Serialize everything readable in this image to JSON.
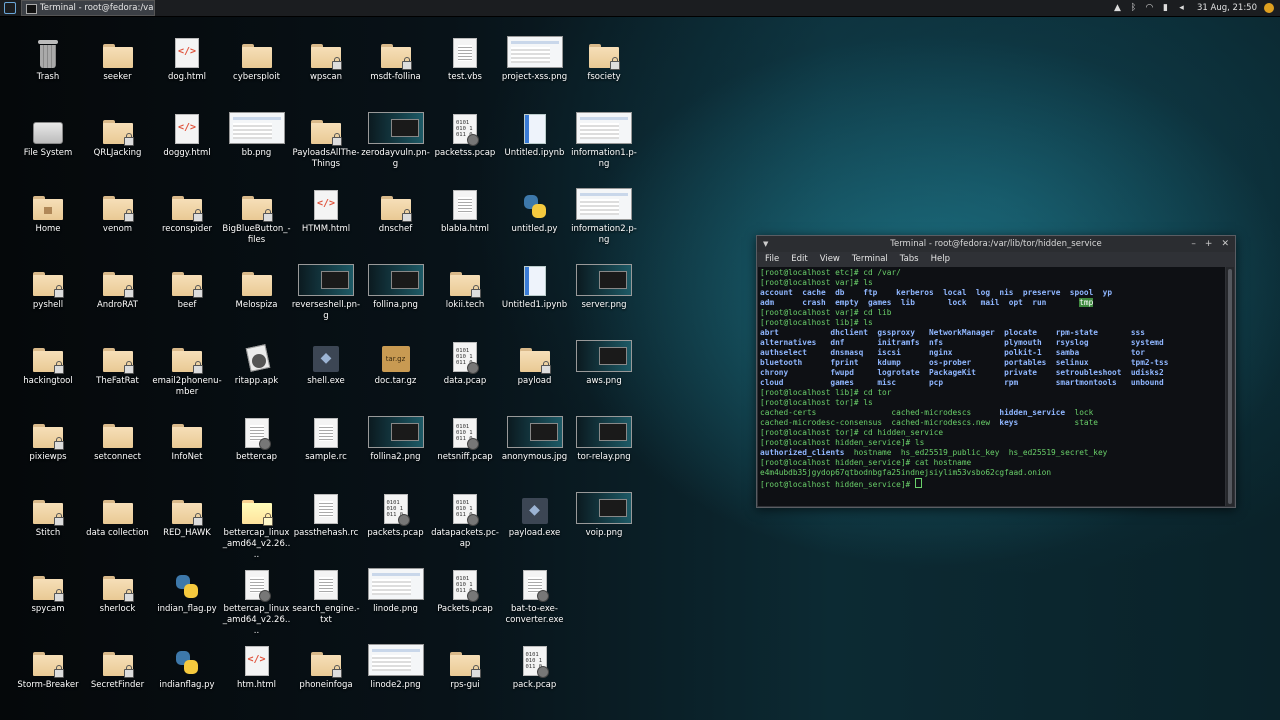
{
  "panel": {
    "task_label": "Terminal - root@fedora:/var...",
    "clock": "31 Aug, 21:50"
  },
  "desktop_icons": [
    {
      "label": "Trash",
      "type": "trash"
    },
    {
      "label": "seeker",
      "type": "folder"
    },
    {
      "label": "dog.html",
      "type": "html"
    },
    {
      "label": "cybersploit",
      "type": "folder"
    },
    {
      "label": "wpscan",
      "type": "folder-lock"
    },
    {
      "label": "msdt-follina",
      "type": "folder-lock"
    },
    {
      "label": "test.vbs",
      "type": "text"
    },
    {
      "label": "project-xss.png",
      "type": "thumb"
    },
    {
      "label": "fsociety",
      "type": "folder-lock"
    },
    {
      "label": "File System",
      "type": "hdd"
    },
    {
      "label": "QRLJacking",
      "type": "folder-lock"
    },
    {
      "label": "doggy.html",
      "type": "html"
    },
    {
      "label": "bb.png",
      "type": "thumb"
    },
    {
      "label": "PayloadsAllThe-Things",
      "type": "folder-lock"
    },
    {
      "label": "zerodayvuln.pn-g",
      "type": "thumb-dark"
    },
    {
      "label": "packetss.pcap",
      "type": "pcap"
    },
    {
      "label": "Untitled.ipynb",
      "type": "nb"
    },
    {
      "label": "information1.p-ng",
      "type": "thumb"
    },
    {
      "label": "Home",
      "type": "home"
    },
    {
      "label": "venom",
      "type": "folder-lock"
    },
    {
      "label": "reconspider",
      "type": "folder-lock"
    },
    {
      "label": "BigBlueButton_-files",
      "type": "folder-lock"
    },
    {
      "label": "HTMM.html",
      "type": "html"
    },
    {
      "label": "dnschef",
      "type": "folder-lock"
    },
    {
      "label": "blabla.html",
      "type": "text"
    },
    {
      "label": "untitled.py",
      "type": "py"
    },
    {
      "label": "information2.p-ng",
      "type": "thumb"
    },
    {
      "label": "pyshell",
      "type": "folder-lock"
    },
    {
      "label": "AndroRAT",
      "type": "folder-lock"
    },
    {
      "label": "beef",
      "type": "folder-lock"
    },
    {
      "label": "Melospiza",
      "type": "folder"
    },
    {
      "label": "reverseshell.pn-g",
      "type": "thumb-dark"
    },
    {
      "label": "follina.png",
      "type": "thumb-dark"
    },
    {
      "label": "lokii.tech",
      "type": "folder-lock"
    },
    {
      "label": "Untitled1.ipynb",
      "type": "nb"
    },
    {
      "label": "server.png",
      "type": "thumb-dark"
    },
    {
      "label": "hackingtool",
      "type": "folder-lock"
    },
    {
      "label": "TheFatRat",
      "type": "folder-lock"
    },
    {
      "label": "email2phonenu-mber",
      "type": "folder-lock"
    },
    {
      "label": "ritapp.apk",
      "type": "apk"
    },
    {
      "label": "shell.exe",
      "type": "exe"
    },
    {
      "label": "doc.tar.gz",
      "type": "tgz"
    },
    {
      "label": "data.pcap",
      "type": "pcap"
    },
    {
      "label": "payload",
      "type": "folder-lock"
    },
    {
      "label": "aws.png",
      "type": "thumb-dark"
    },
    {
      "label": "pixiewps",
      "type": "folder-lock"
    },
    {
      "label": "setconnect",
      "type": "folder"
    },
    {
      "label": "InfoNet",
      "type": "folder"
    },
    {
      "label": "bettercap",
      "type": "gear-doc"
    },
    {
      "label": "sample.rc",
      "type": "text"
    },
    {
      "label": "follina2.png",
      "type": "thumb-dark"
    },
    {
      "label": "netsniff.pcap",
      "type": "pcap"
    },
    {
      "label": "anonymous.jpg",
      "type": "thumb-dark"
    },
    {
      "label": "tor-relay.png",
      "type": "thumb-dark"
    },
    {
      "label": "Stitch",
      "type": "folder-lock"
    },
    {
      "label": "data collection",
      "type": "folder"
    },
    {
      "label": "RED_HAWK",
      "type": "folder-lock"
    },
    {
      "label": "bettercap_linux_amd64_v2.26....",
      "type": "folder-box"
    },
    {
      "label": "passthehash.rc",
      "type": "text"
    },
    {
      "label": "packets.pcap",
      "type": "pcap"
    },
    {
      "label": "datapackets.pc-ap",
      "type": "pcap"
    },
    {
      "label": "payload.exe",
      "type": "exe"
    },
    {
      "label": "voip.png",
      "type": "thumb-dark"
    },
    {
      "label": "spycam",
      "type": "folder-lock"
    },
    {
      "label": "sherlock",
      "type": "folder-lock"
    },
    {
      "label": "indian_flag.py",
      "type": "py"
    },
    {
      "label": "bettercap_linux_amd64_v2.26....",
      "type": "gear-doc"
    },
    {
      "label": "search_engine.-txt",
      "type": "text"
    },
    {
      "label": "linode.png",
      "type": "thumb"
    },
    {
      "label": "Packets.pcap",
      "type": "pcap"
    },
    {
      "label": "bat-to-exe-converter.exe",
      "type": "gear-doc"
    },
    {
      "label": "Storm-Breaker",
      "type": "folder-lock"
    },
    {
      "label": "SecretFinder",
      "type": "folder-lock"
    },
    {
      "label": "indianflag.py",
      "type": "py"
    },
    {
      "label": "htm.html",
      "type": "html"
    },
    {
      "label": "phoneinfoga",
      "type": "folder-lock"
    },
    {
      "label": "linode2.png",
      "type": "thumb"
    },
    {
      "label": "rps-gui",
      "type": "folder-lock"
    },
    {
      "label": "pack.pcap",
      "type": "pcap"
    }
  ],
  "terminal": {
    "title": "Terminal - root@fedora:/var/lib/tor/hidden_service",
    "menu": [
      "File",
      "Edit",
      "View",
      "Terminal",
      "Tabs",
      "Help"
    ],
    "lines": [
      [
        {
          "t": "[root@localhost etc]# ",
          "c": "g"
        },
        {
          "t": "cd /var/",
          "c": "g"
        }
      ],
      [
        {
          "t": "[root@localhost var]# ",
          "c": "g"
        },
        {
          "t": "ls",
          "c": "g"
        }
      ],
      [
        {
          "t": "account  cache  db    ftp    kerberos  local  log  nis  preserve  spool  yp",
          "c": "b"
        }
      ],
      [
        {
          "t": "adm      crash  empty  games  lib       lock   mail  opt  run       ",
          "c": "b"
        },
        {
          "t": "tmp",
          "c": "hl"
        }
      ],
      [
        {
          "t": "[root@localhost var]# ",
          "c": "g"
        },
        {
          "t": "cd lib",
          "c": "g"
        }
      ],
      [
        {
          "t": "[root@localhost lib]# ",
          "c": "g"
        },
        {
          "t": "ls",
          "c": "g"
        }
      ],
      [
        {
          "t": "abrt           dhclient  gssproxy   NetworkManager  plocate    rpm-state       sss",
          "c": "b"
        }
      ],
      [
        {
          "t": "alternatives   dnf       initramfs  nfs             plymouth   rsyslog         systemd",
          "c": "b"
        }
      ],
      [
        {
          "t": "authselect     dnsmasq   iscsi      nginx           polkit-1   samba           tor",
          "c": "b"
        }
      ],
      [
        {
          "t": "bluetooth      fprint    kdump      os-prober       portables  selinux         tpm2-tss",
          "c": "b"
        }
      ],
      [
        {
          "t": "chrony         fwupd     logrotate  PackageKit      private    setroubleshoot  udisks2",
          "c": "b"
        }
      ],
      [
        {
          "t": "cloud          games     misc       pcp             rpm        smartmontools   unbound",
          "c": "b"
        }
      ],
      [
        {
          "t": "[root@localhost lib]# ",
          "c": "g"
        },
        {
          "t": "cd tor",
          "c": "g"
        }
      ],
      [
        {
          "t": "[root@localhost tor]# ",
          "c": "g"
        },
        {
          "t": "ls",
          "c": "g"
        }
      ],
      [
        {
          "t": "cached-certs                cached-microdescs      ",
          "c": "g"
        },
        {
          "t": "hidden_service",
          "c": "b"
        },
        {
          "t": "  lock",
          "c": "g"
        }
      ],
      [
        {
          "t": "cached-microdesc-consensus  cached-microdescs.new  ",
          "c": "g"
        },
        {
          "t": "keys",
          "c": "b"
        },
        {
          "t": "            state",
          "c": "g"
        }
      ],
      [
        {
          "t": "[root@localhost tor]# ",
          "c": "g"
        },
        {
          "t": "cd hidden_service",
          "c": "g"
        }
      ],
      [
        {
          "t": "[root@localhost hidden_service]# ",
          "c": "g"
        },
        {
          "t": "ls",
          "c": "g"
        }
      ],
      [
        {
          "t": "authorized_clients",
          "c": "b"
        },
        {
          "t": "  hostname  hs_ed25519_public_key  hs_ed25519_secret_key",
          "c": "g"
        }
      ],
      [
        {
          "t": "[root@localhost hidden_service]# ",
          "c": "g"
        },
        {
          "t": "cat hostname",
          "c": "g"
        }
      ],
      [
        {
          "t": "e4m4ubdb35jgydop67qtbodnbgfa25indnejsiylim53vsbo62cgfaad.onion",
          "c": "g"
        }
      ],
      [
        {
          "t": "[root@localhost hidden_service]# ",
          "c": "g"
        }
      ]
    ]
  }
}
